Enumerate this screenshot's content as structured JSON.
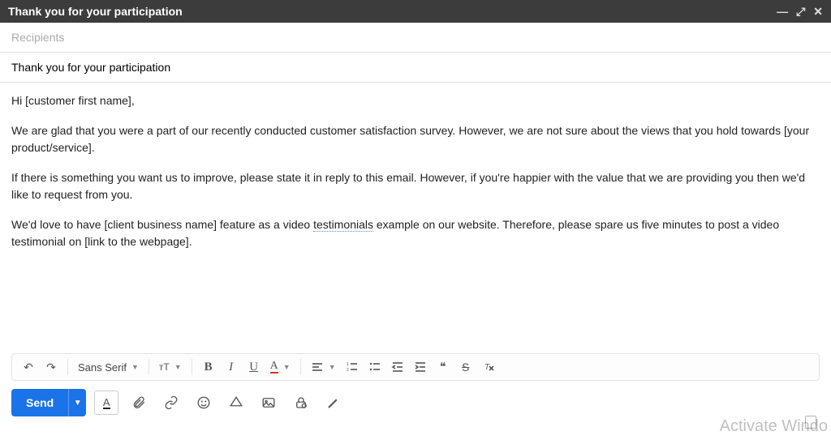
{
  "titlebar": {
    "title": "Thank you for your participation"
  },
  "recipients": {
    "placeholder": "Recipients"
  },
  "subject": {
    "value": "Thank you for your participation"
  },
  "body": {
    "p1": "Hi [customer first name],",
    "p2": "We are glad that you were a part of our recently conducted customer satisfaction survey. However, we are not sure about the views that you hold towards [your product/service].",
    "p3": "If there is something you want us to improve, please state it in reply to this email. However, if you're happier with the value that we are providing you then we'd like to request from you.",
    "p4_a": "We'd love to have [client business name] feature as a video ",
    "p4_spell": "testimonials",
    "p4_b": " example on our website. Therefore, please spare us five minutes to post a video testimonial on [link to the webpage]."
  },
  "toolbar": {
    "undo": "↶",
    "redo": "↷",
    "font_name": "Sans Serif",
    "size_glyph": "ᴛT",
    "bold": "B",
    "italic": "I",
    "underline": "U",
    "text_color": "A",
    "quote": "❝",
    "strike": "S",
    "clear_format": "ᵪT"
  },
  "actions": {
    "send_label": "Send",
    "text_color_A": "A"
  },
  "watermark": "Activate Windo"
}
